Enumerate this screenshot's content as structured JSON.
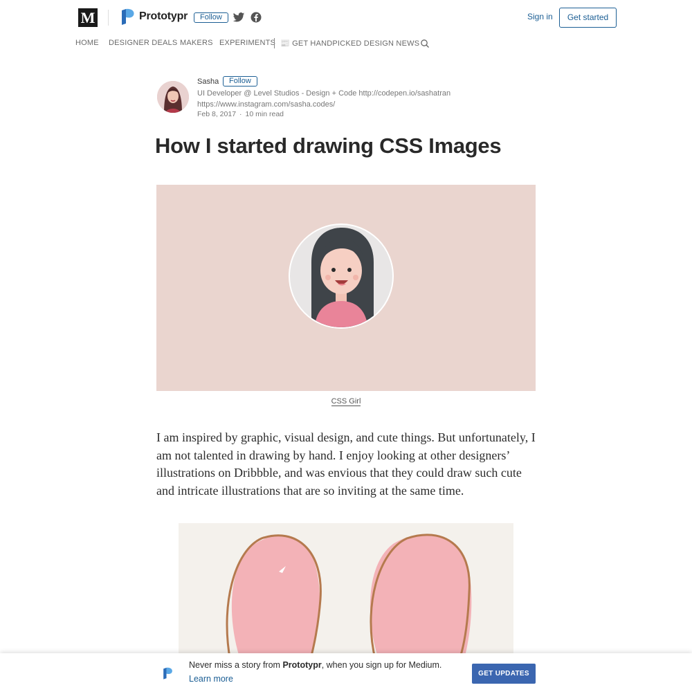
{
  "header": {
    "medium_logo": "M",
    "publication_name": "Prototypr",
    "follow_label": "Follow",
    "sign_in": "Sign in",
    "get_started": "Get started"
  },
  "nav": {
    "items": [
      "HOME",
      "DESIGNER DEALS",
      "MAKERS",
      "EXPERIMENTS"
    ],
    "newsletter": "📰 GET HANDPICKED DESIGN NEWS"
  },
  "author": {
    "name": "Sasha",
    "follow_label": "Follow",
    "bio_line1": "UI Developer @ Level Studios - Design + Code http://codepen.io/sashatran",
    "bio_line2": "https://www.instagram.com/sasha.codes/",
    "date": "Feb 8, 2017",
    "read_time": "10 min read"
  },
  "article": {
    "title": "How I started drawing CSS Images",
    "figure1_caption": "CSS Girl",
    "paragraph1": "I am inspired by graphic, visual design, and cute things. But unfortunately, I am not talented in drawing by hand. I enjoy looking at other designers’ illustrations on Dribbble, and was envious that they could draw such cute and intricate illustrations that are so inviting at the same time."
  },
  "banner": {
    "text_prefix": "Never miss a story from ",
    "publication": "Prototypr",
    "text_suffix": ", when you sign up for Medium.",
    "learn_more": "Learn more",
    "cta": "GET UPDATES"
  },
  "colors": {
    "accent": "#1b5e94",
    "hero_background": "#ead5cf",
    "cta_background": "#3b66b0"
  }
}
